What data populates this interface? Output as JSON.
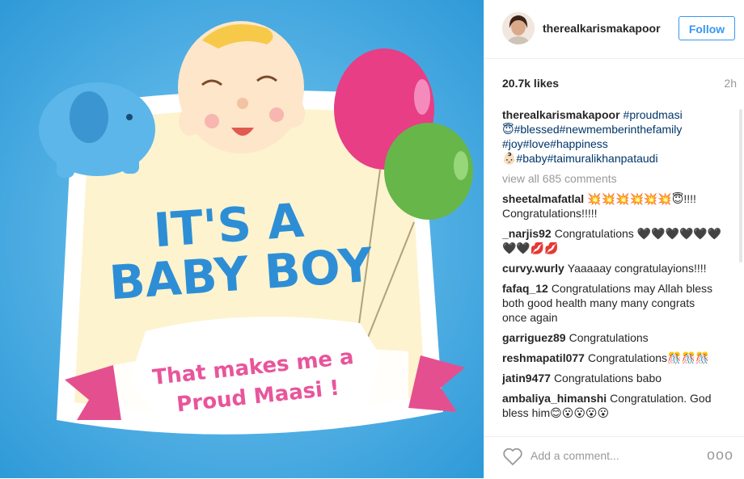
{
  "header": {
    "username": "therealkarismakapoor",
    "follow_label": "Follow"
  },
  "post": {
    "likes": "20.7k likes",
    "time": "2h"
  },
  "caption": {
    "username": "therealkarismakapoor",
    "line1": "#proudmasi",
    "line2": "😇#blessed#newmemberinthefamily",
    "line3": "#joy#love#happiness",
    "line4": "👶🏻#baby#taimuralikhanpataudi"
  },
  "view_all": "view all 685 comments",
  "comments": [
    {
      "user": "sheetalmafatlal",
      "text": "💥💥💥💥💥💥😇!!!! Congratulations!!!!!"
    },
    {
      "user": "_narjis92",
      "text": "Congratulations 🖤🖤🖤🖤🖤🖤🖤🖤💋💋"
    },
    {
      "user": "curvy.wurly",
      "text": "Yaaaaay congratulayions!!!!"
    },
    {
      "user": "fafaq_12",
      "text": "Congratulations may Allah bless both good health many many congrats once again"
    },
    {
      "user": "garriguez89",
      "text": "Congratulations"
    },
    {
      "user": "reshmapatil077",
      "text": "Congratulations🎊🎊🎊"
    },
    {
      "user": "jatin9477",
      "text": "Congratulations babo"
    },
    {
      "user": "ambaliya_himanshi",
      "text": "Congratulation. God bless him😊😮😮😮😮"
    }
  ],
  "add_comment_placeholder": "Add a comment...",
  "more_label": "ooo",
  "image": {
    "line1": "IT'S A",
    "line2": "BABY BOY",
    "banner1": "That makes me a",
    "banner2": "Proud Maasi !"
  },
  "colors": {
    "sky": "#3ea6e1",
    "pink_text": "#e8559b",
    "blue_text": "#2d8ed6",
    "follow": "#3897f0",
    "hashtag": "#003569"
  },
  "icons": {
    "heart": "heart-outline-icon",
    "more": "more-dots-icon"
  }
}
